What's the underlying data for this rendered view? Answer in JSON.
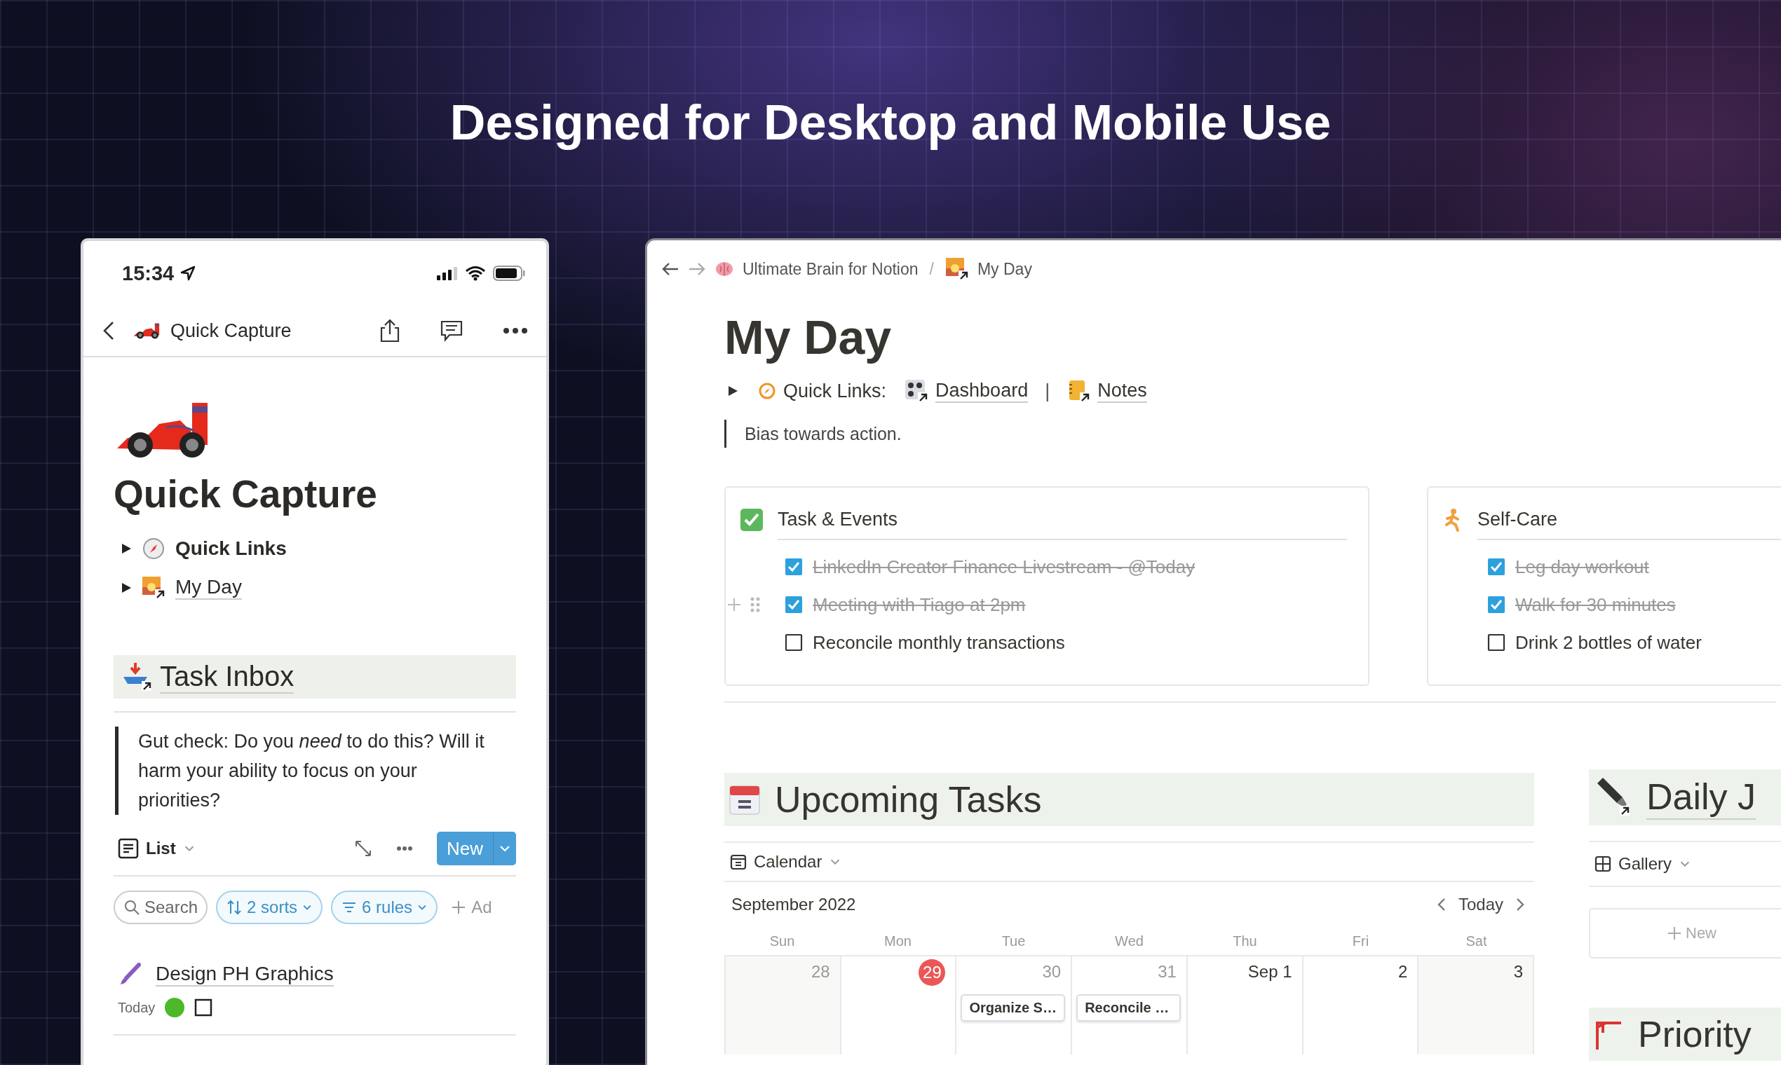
{
  "headline": "Designed for Desktop and Mobile Use",
  "phone": {
    "status_time": "15:34",
    "nav_title": "Quick Capture",
    "page_title": "Quick Capture",
    "toggles": [
      {
        "kind": "text",
        "label": "Quick Links",
        "expanded": false
      },
      {
        "kind": "link",
        "label": "My Day",
        "expanded": false
      }
    ],
    "section_title": "Task Inbox",
    "quote": "Gut check: Do you *need* to do this? Will it harm your ability to focus on your priorities?",
    "view": "List",
    "new_button": "New",
    "chips": [
      {
        "kind": "search",
        "label": "Search"
      },
      {
        "kind": "sort",
        "label": "2 sorts"
      },
      {
        "kind": "filter",
        "label": "6 rules"
      },
      {
        "kind": "add",
        "label": "Ad"
      }
    ],
    "tasks": [
      {
        "title": "Design PH Graphics",
        "date": "Today",
        "done": false
      }
    ]
  },
  "desktop": {
    "breadcrumb": [
      "Ultimate Brain for Notion",
      "My Day"
    ],
    "breadcrumb_separator": "/",
    "title": "My Day",
    "quick_links_label": "Quick Links:",
    "quick_links": [
      "Dashboard",
      "Notes"
    ],
    "separator": "|",
    "quote": "Bias towards action.",
    "cards": [
      {
        "title": "Task & Events",
        "items": [
          {
            "label": "LinkedIn Creator Finance Livestream - @Today",
            "checked": true,
            "hovered": false
          },
          {
            "label": "Meeting with Tiago at 2pm",
            "checked": true,
            "hovered": true
          },
          {
            "label": "Reconcile monthly transactions",
            "checked": false,
            "hovered": false
          }
        ]
      },
      {
        "title": "Self-Care",
        "items": [
          {
            "label": "Leg day workout",
            "checked": true,
            "hovered": false
          },
          {
            "label": "Walk for 30 minutes",
            "checked": true,
            "hovered": false
          },
          {
            "label": "Drink 2 bottles of water",
            "checked": false,
            "hovered": false
          }
        ]
      }
    ],
    "upcoming": {
      "title": "Upcoming Tasks",
      "view": "Calendar",
      "month": "September 2022",
      "today_button": "Today",
      "weekdays": [
        "Sun",
        "Mon",
        "Tue",
        "Wed",
        "Thu",
        "Fri",
        "Sat"
      ],
      "days": [
        {
          "label": "28",
          "in_month": false,
          "today": false
        },
        {
          "label": "29",
          "in_month": false,
          "today": true
        },
        {
          "label": "30",
          "in_month": false,
          "today": false,
          "events": [
            "Organize S…"
          ]
        },
        {
          "label": "31",
          "in_month": false,
          "today": false,
          "events": [
            "Reconcile …"
          ]
        },
        {
          "label": "Sep 1",
          "in_month": true,
          "today": false
        },
        {
          "label": "2",
          "in_month": true,
          "today": false
        },
        {
          "label": "3",
          "in_month": true,
          "today": false
        }
      ]
    },
    "journal": {
      "title": "Daily J",
      "view": "Gallery",
      "new_label": "New"
    },
    "priority": {
      "title": "Priority"
    }
  }
}
